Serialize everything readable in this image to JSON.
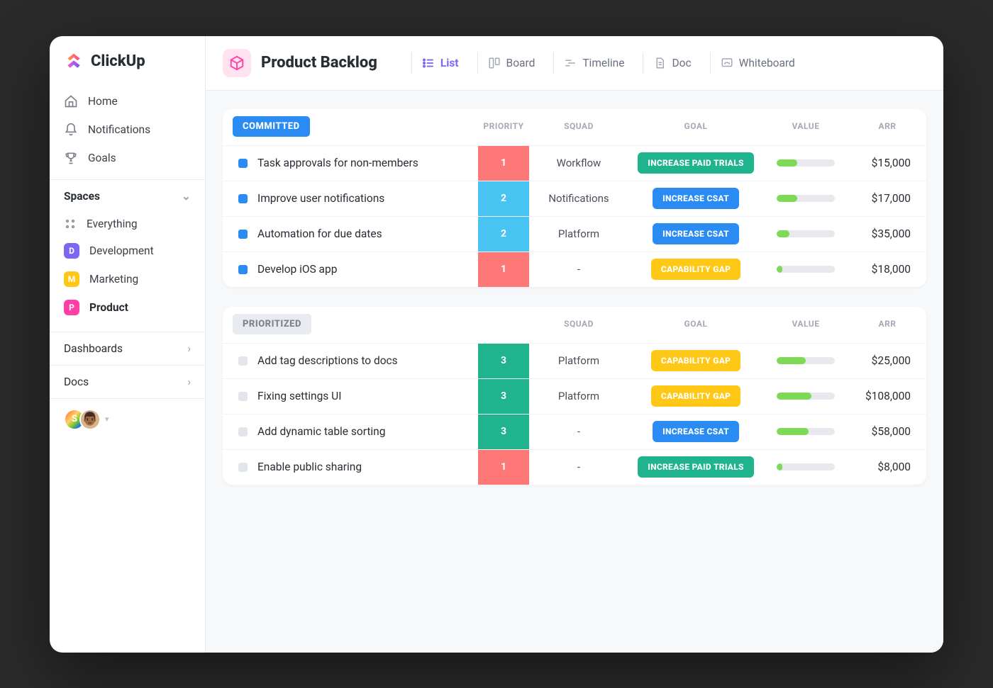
{
  "brand": {
    "name": "ClickUp"
  },
  "sidebar": {
    "nav": [
      {
        "label": "Home"
      },
      {
        "label": "Notifications"
      },
      {
        "label": "Goals"
      }
    ],
    "spaces_label": "Spaces",
    "spaces": [
      {
        "label": "Everything",
        "kind": "all"
      },
      {
        "label": "Development",
        "initial": "D",
        "color": "#7b68ee"
      },
      {
        "label": "Marketing",
        "initial": "M",
        "color": "#ffc817"
      },
      {
        "label": "Product",
        "initial": "P",
        "color": "#ff3fa3",
        "active": true
      }
    ],
    "dashboards_label": "Dashboards",
    "docs_label": "Docs",
    "avatars": [
      {
        "initial": "S"
      },
      {
        "emoji": "👨🏾"
      }
    ]
  },
  "header": {
    "title": "Product Backlog",
    "tabs": [
      {
        "label": "List",
        "active": true
      },
      {
        "label": "Board"
      },
      {
        "label": "Timeline"
      },
      {
        "label": "Doc"
      },
      {
        "label": "Whiteboard"
      }
    ]
  },
  "columns": {
    "priority": "PRIORITY",
    "squad": "SQUAD",
    "goal": "GOAL",
    "value": "VALUE",
    "arr": "ARR"
  },
  "groups": [
    {
      "name": "COMMITTED",
      "style": "committed",
      "status": "blue",
      "show_priority_header": true,
      "rows": [
        {
          "name": "Task approvals for non-members",
          "priority": "1",
          "pclass": "p-red",
          "squad": "Workflow",
          "goal": "INCREASE PAID TRIALS",
          "gclass": "g-green",
          "value_pct": 35,
          "arr": "$15,000"
        },
        {
          "name": "Improve  user notifications",
          "priority": "2",
          "pclass": "p-blue",
          "squad": "Notifications",
          "goal": "INCREASE CSAT",
          "gclass": "g-blue",
          "value_pct": 35,
          "arr": "$17,000"
        },
        {
          "name": "Automation for due dates",
          "priority": "2",
          "pclass": "p-blue",
          "squad": "Platform",
          "goal": "INCREASE CSAT",
          "gclass": "g-blue",
          "value_pct": 22,
          "arr": "$35,000"
        },
        {
          "name": "Develop iOS app",
          "priority": "1",
          "pclass": "p-red",
          "squad": "-",
          "goal": "CAPABILITY GAP",
          "gclass": "g-yellow",
          "value_pct": 10,
          "arr": "$18,000"
        }
      ]
    },
    {
      "name": "PRIORITIZED",
      "style": "prioritized",
      "status": "gray",
      "show_priority_header": false,
      "rows": [
        {
          "name": "Add tag descriptions to docs",
          "priority": "3",
          "pclass": "p-green",
          "squad": "Platform",
          "goal": "CAPABILITY GAP",
          "gclass": "g-yellow",
          "value_pct": 50,
          "arr": "$25,000"
        },
        {
          "name": "Fixing settings UI",
          "priority": "3",
          "pclass": "p-green",
          "squad": "Platform",
          "goal": "CAPABILITY GAP",
          "gclass": "g-yellow",
          "value_pct": 60,
          "arr": "$108,000"
        },
        {
          "name": "Add dynamic table sorting",
          "priority": "3",
          "pclass": "p-green",
          "squad": "-",
          "goal": "INCREASE CSAT",
          "gclass": "g-blue",
          "value_pct": 55,
          "arr": "$58,000"
        },
        {
          "name": "Enable public sharing",
          "priority": "1",
          "pclass": "p-red",
          "squad": "-",
          "goal": "INCREASE PAID TRIALS",
          "gclass": "g-green",
          "value_pct": 10,
          "arr": "$8,000"
        }
      ]
    }
  ]
}
